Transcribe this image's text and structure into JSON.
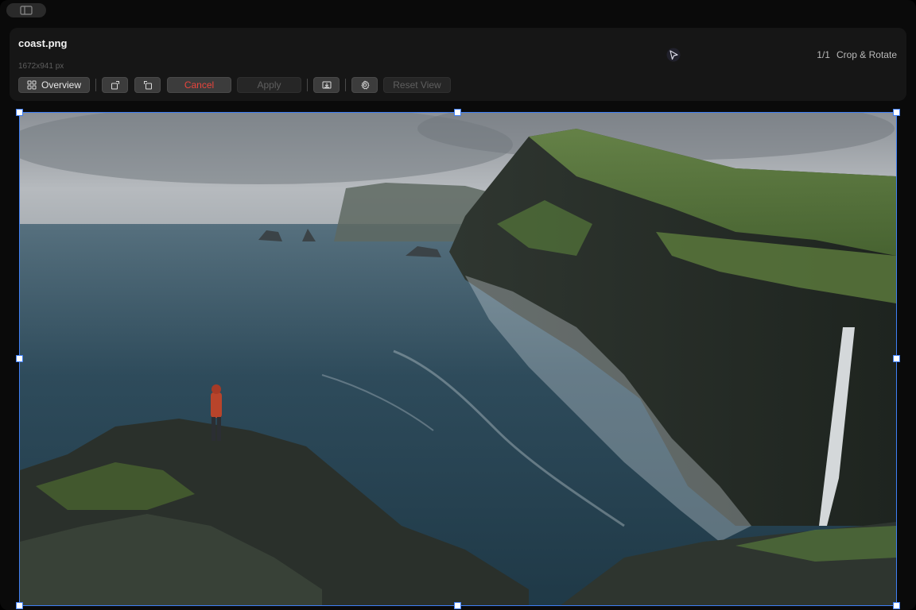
{
  "file": {
    "name": "coast.png",
    "dimensions": "1672x941 px"
  },
  "status": {
    "page": "1/1",
    "mode": "Crop & Rotate"
  },
  "toolbar": {
    "overview_label": "Overview",
    "cancel_label": "Cancel",
    "apply_label": "Apply",
    "reset_view_label": "Reset View"
  },
  "icons": {
    "top_pill": "sidebar-toggle-icon",
    "overview": "grid-icon",
    "rotate_right": "rotate-right-icon",
    "rotate_left": "rotate-left-icon",
    "export": "export-icon",
    "settings": "gear-icon",
    "cursor": "pointer-cursor-icon"
  },
  "colors": {
    "accent": "#3f7ff5",
    "cancel": "#e8453c",
    "header_bg": "#161616",
    "window_bg": "#0a0a0a"
  }
}
